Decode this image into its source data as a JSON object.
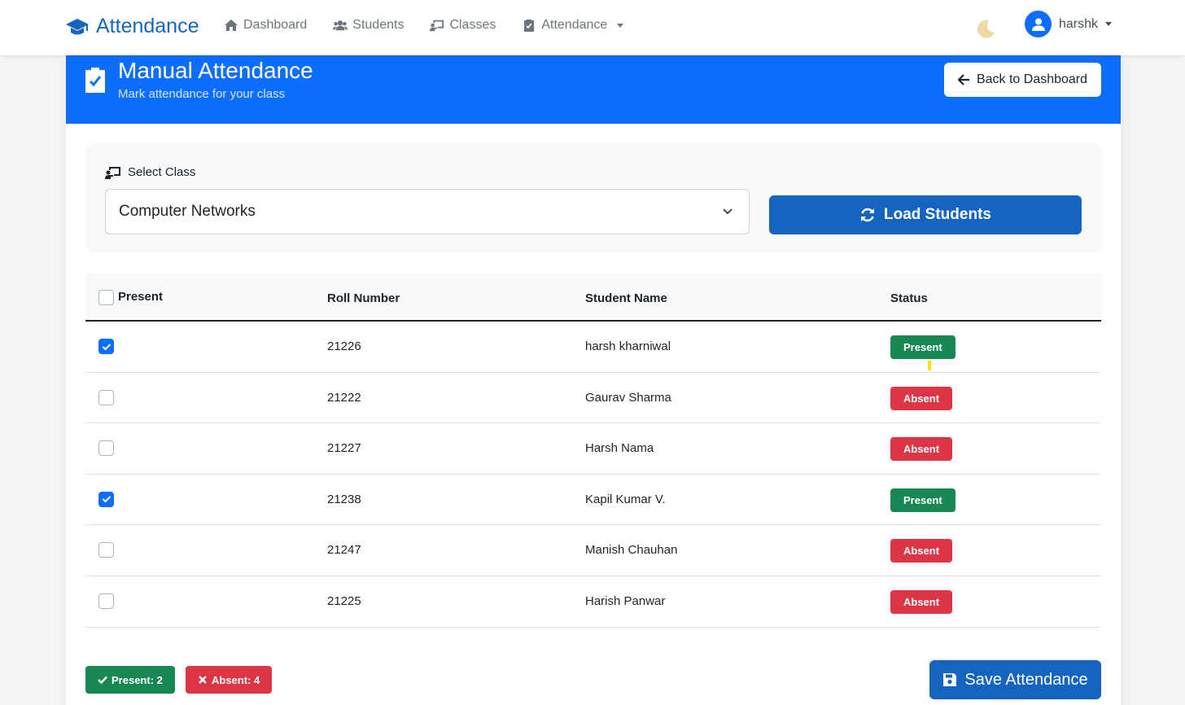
{
  "navbar": {
    "brand": "Attendance",
    "links": [
      {
        "label": "Dashboard",
        "icon": "home-icon"
      },
      {
        "label": "Students",
        "icon": "users-icon"
      },
      {
        "label": "Classes",
        "icon": "chalkboard-icon"
      },
      {
        "label": "Attendance",
        "icon": "clipboard-check-icon",
        "dropdown": true
      }
    ],
    "user": "harshk"
  },
  "header": {
    "title": "Manual Attendance",
    "subtitle": "Mark attendance for your class",
    "back_label": "Back to Dashboard"
  },
  "class_select": {
    "label": "Select Class",
    "value": "Computer Networks",
    "load_label": "Load Students"
  },
  "table": {
    "headers": [
      "Present",
      "Roll Number",
      "Student Name",
      "Status"
    ],
    "rows": [
      {
        "checked": true,
        "roll": "21226",
        "name": "harsh kharniwal",
        "status": "Present"
      },
      {
        "checked": false,
        "roll": "21222",
        "name": "Gaurav Sharma",
        "status": "Absent"
      },
      {
        "checked": false,
        "roll": "21227",
        "name": "Harsh Nama",
        "status": "Absent"
      },
      {
        "checked": true,
        "roll": "21238",
        "name": "Kapil Kumar V.",
        "status": "Present"
      },
      {
        "checked": false,
        "roll": "21247",
        "name": "Manish Chauhan",
        "status": "Absent"
      },
      {
        "checked": false,
        "roll": "21225",
        "name": "Harish Panwar",
        "status": "Absent"
      }
    ]
  },
  "summary": {
    "present": "Present: 2",
    "absent": "Absent: 4"
  },
  "save_label": "Save Attendance",
  "colors": {
    "primary": "#0d6efd",
    "brand": "#1565c0",
    "success": "#198754",
    "danger": "#dc3545"
  }
}
